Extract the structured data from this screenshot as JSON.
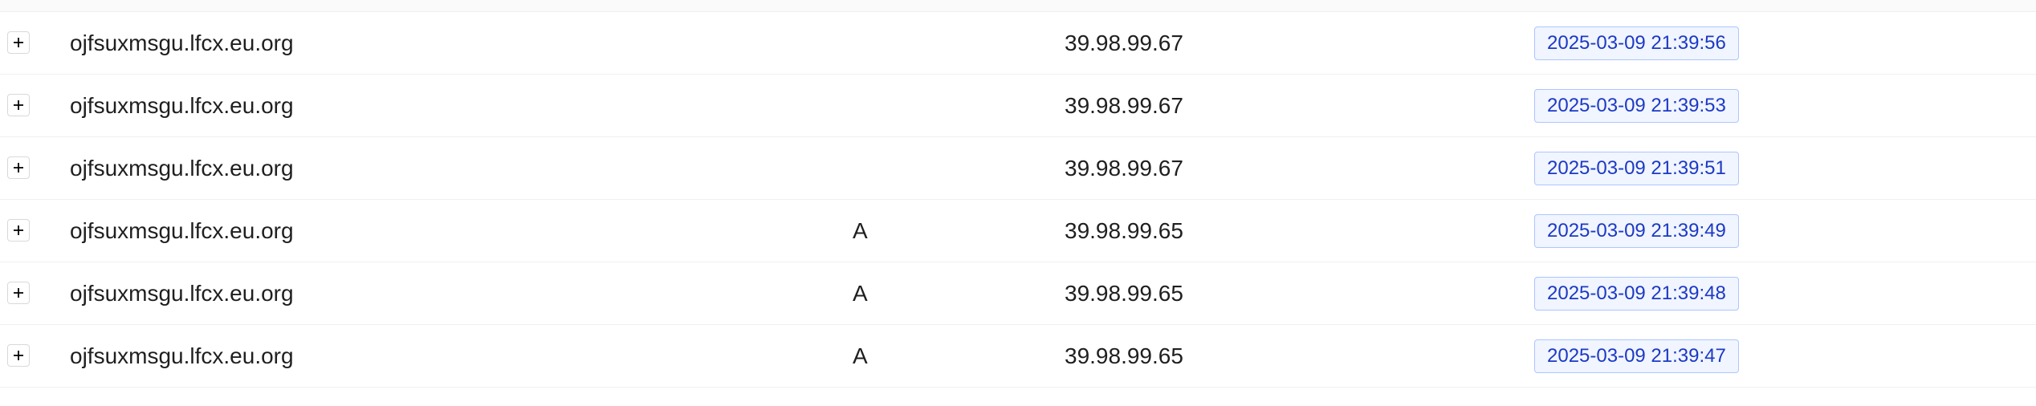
{
  "theme": {
    "tag_text_color": "#1d39c4",
    "tag_bg_color": "#f0f5ff",
    "tag_border_color": "#adc6ff"
  },
  "rows": [
    {
      "domain": "ojfsuxmsgu.lfcx.eu.org",
      "type": "",
      "ip": "39.98.99.67",
      "time": "2025-03-09 21:39:56"
    },
    {
      "domain": "ojfsuxmsgu.lfcx.eu.org",
      "type": "",
      "ip": "39.98.99.67",
      "time": "2025-03-09 21:39:53"
    },
    {
      "domain": "ojfsuxmsgu.lfcx.eu.org",
      "type": "",
      "ip": "39.98.99.67",
      "time": "2025-03-09 21:39:51"
    },
    {
      "domain": "ojfsuxmsgu.lfcx.eu.org",
      "type": "A",
      "ip": "39.98.99.65",
      "time": "2025-03-09 21:39:49"
    },
    {
      "domain": "ojfsuxmsgu.lfcx.eu.org",
      "type": "A",
      "ip": "39.98.99.65",
      "time": "2025-03-09 21:39:48"
    },
    {
      "domain": "ojfsuxmsgu.lfcx.eu.org",
      "type": "A",
      "ip": "39.98.99.65",
      "time": "2025-03-09 21:39:47"
    }
  ],
  "icons": {
    "expand": "plus-icon"
  }
}
